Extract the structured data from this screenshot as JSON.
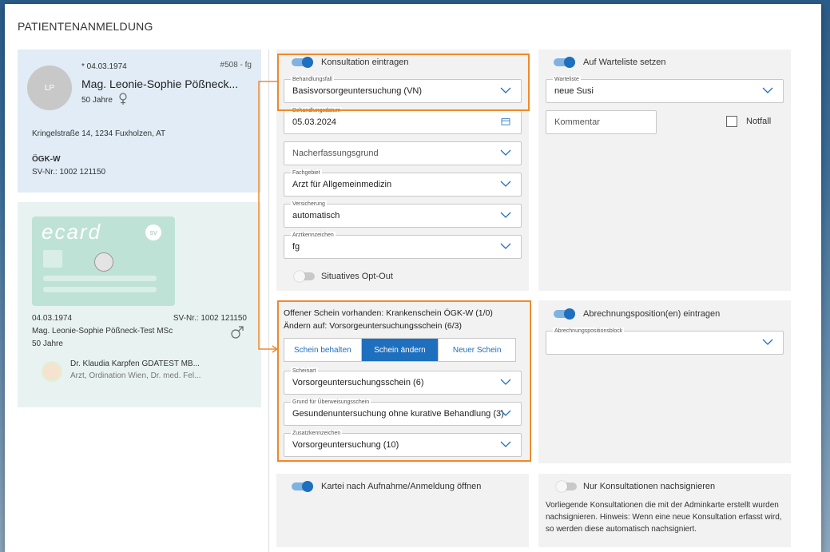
{
  "dialog": {
    "title": "PATIENTENANMELDUNG"
  },
  "patient": {
    "initials": "LP",
    "birthdate": "* 04.03.1974",
    "id": "#508 - fg",
    "name": "Mag. Leonie-Sophie Pößneck...",
    "age": "50 Jahre",
    "address": "Kringelstraße 14, 1234 Fuxholzen, AT",
    "insurance": "ÖGK-W",
    "svnr": "SV-Nr.: 1002 121150"
  },
  "ecard": {
    "logo_text": "ecard",
    "badge": "sv",
    "birthdate": "04.03.1974",
    "svnr": "SV-Nr.: 1002 121150",
    "name": "Mag. Leonie-Sophie Pößneck-Test MSc",
    "age": "50 Jahre",
    "doctor_name": "Dr. Klaudia Karpfen GDATEST MB...",
    "doctor_detail": "Arzt, Ordination Wien, Dr. med. Fel..."
  },
  "consultation": {
    "toggle_label": "Konsultation eintragen",
    "toggle_on": true,
    "behandlungsfall_label": "Behandlungsfall",
    "behandlungsfall_value": "Basisvorsorgeuntersuchung (VN)",
    "date_label": "Behandlungsdatum",
    "date_value": "05.03.2024",
    "nacherfassung_placeholder": "Nacherfassungsgrund",
    "fachgebiet_label": "Fachgebiet",
    "fachgebiet_value": "Arzt für Allgemeinmedizin",
    "versicherung_label": "Versicherung",
    "versicherung_value": "automatisch",
    "arztkennzeichen_label": "Arztkennzeichen",
    "arztkennzeichen_value": "fg",
    "optout_label": "Situatives Opt-Out",
    "optout_on": false
  },
  "schein": {
    "line1": "Offener Schein vorhanden: Krankenschein ÖGK-W (1/0)",
    "line2": "Ändern auf: Vorsorgeuntersuchungsschein (6/3)",
    "buttons": [
      "Schein behalten",
      "Schein ändern",
      "Neuer Schein"
    ],
    "active_button": "Schein ändern",
    "scheinart_label": "Scheinart",
    "scheinart_value": "Vorsorgeuntersuchungsschein (6)",
    "grund_label": "Grund für Überweisungsschein",
    "grund_value": "Gesundenuntersuchung ohne kurative Behandlung (3)",
    "zusatz_label": "Zusatzkennzeichen",
    "zusatz_value": "Vorsorgeuntersuchung (10)"
  },
  "warteliste": {
    "toggle_label": "Auf Warteliste setzen",
    "toggle_on": true,
    "list_label": "Warteliste",
    "list_value": "neue Susi",
    "comment_placeholder": "Kommentar",
    "notfall_label": "Notfall",
    "notfall_checked": false
  },
  "abrechnung": {
    "toggle_label": "Abrechnungsposition(en) eintragen",
    "toggle_on": true,
    "block_label": "Abrechnungspositionsblock",
    "block_value": ""
  },
  "kartei": {
    "toggle_label": "Kartei nach Aufnahme/Anmeldung öffnen",
    "toggle_on": true
  },
  "nachsignieren": {
    "toggle_label": "Nur Konsultationen nachsignieren",
    "toggle_on": false,
    "description": "Vorliegende Konsultationen die mit der Adminkarte erstellt wurden nachsignieren. Hinweis: Wenn eine neue Konsultation erfasst wird, so werden diese automatisch nachsigniert."
  },
  "colors": {
    "accent": "#1e6fbd",
    "highlight": "#ef8a2a",
    "patient_bg": "#e1ecf6",
    "ecard_bg": "#e8f3f1"
  }
}
